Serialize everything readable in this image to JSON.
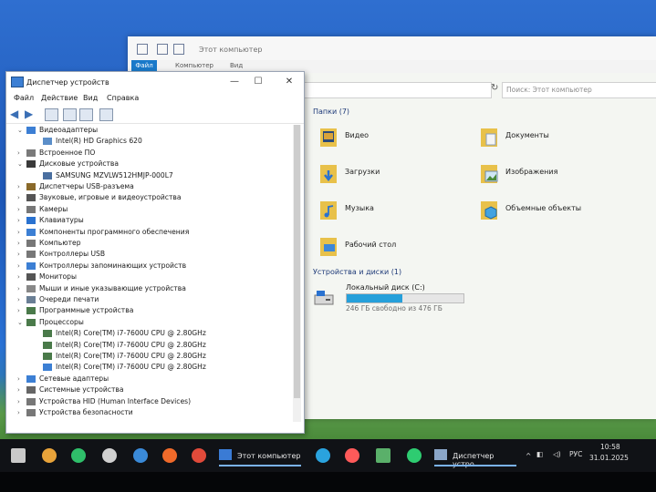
{
  "explorer": {
    "title": "Этот компьютер",
    "ribbon_tabs": [
      "Файл",
      "Компьютер",
      "Вид"
    ],
    "search_placeholder": "Поиск: Этот компьютер",
    "folders_header": "Папки (7)",
    "folders": [
      {
        "label": "Видео",
        "icon": "video-folder-icon"
      },
      {
        "label": "Документы",
        "icon": "documents-folder-icon"
      },
      {
        "label": "Загрузки",
        "icon": "downloads-folder-icon"
      },
      {
        "label": "Изображения",
        "icon": "pictures-folder-icon"
      },
      {
        "label": "Музыка",
        "icon": "music-folder-icon"
      },
      {
        "label": "Объемные объекты",
        "icon": "3d-objects-folder-icon"
      },
      {
        "label": "Рабочий стол",
        "icon": "desktop-folder-icon"
      }
    ],
    "drives_header": "Устройства и диски (1)",
    "drive": {
      "label": "Локальный диск (C:)",
      "free_text": "246 ГБ свободно из 476 ГБ",
      "used_fraction": 0.48
    }
  },
  "devmgr": {
    "title": "Диспетчер устройств",
    "menu": [
      "Файл",
      "Действие",
      "Вид",
      "Справка"
    ],
    "tree": [
      {
        "label": "Видеоадаптеры",
        "level": 0,
        "expanded": true
      },
      {
        "label": "Intel(R) HD Graphics 620",
        "level": 1
      },
      {
        "label": "Встроенное ПО",
        "level": 0
      },
      {
        "label": "Дисковые устройства",
        "level": 0,
        "expanded": true
      },
      {
        "label": "SAMSUNG MZVLW512HMJP-000L7",
        "level": 1
      },
      {
        "label": "Диспетчеры USB-разъема",
        "level": 0
      },
      {
        "label": "Звуковые, игровые и видеоустройства",
        "level": 0
      },
      {
        "label": "Камеры",
        "level": 0
      },
      {
        "label": "Клавиатуры",
        "level": 0
      },
      {
        "label": "Компоненты программного обеспечения",
        "level": 0
      },
      {
        "label": "Компьютер",
        "level": 0
      },
      {
        "label": "Контроллеры USB",
        "level": 0
      },
      {
        "label": "Контроллеры запоминающих устройств",
        "level": 0
      },
      {
        "label": "Мониторы",
        "level": 0
      },
      {
        "label": "Мыши и иные указывающие устройства",
        "level": 0
      },
      {
        "label": "Очереди печати",
        "level": 0
      },
      {
        "label": "Программные устройства",
        "level": 0
      },
      {
        "label": "Процессоры",
        "level": 0,
        "expanded": true
      },
      {
        "label": "Intel(R) Core(TM) i7-7600U CPU @ 2.80GHz",
        "level": 1
      },
      {
        "label": "Intel(R) Core(TM) i7-7600U CPU @ 2.80GHz",
        "level": 1
      },
      {
        "label": "Intel(R) Core(TM) i7-7600U CPU @ 2.80GHz",
        "level": 1
      },
      {
        "label": "Intel(R) Core(TM) i7-7600U CPU @ 2.80GHz",
        "level": 1
      },
      {
        "label": "Сетевые адаптеры",
        "level": 0
      },
      {
        "label": "Системные устройства",
        "level": 0
      },
      {
        "label": "Устройства HID (Human Interface Devices)",
        "level": 0
      },
      {
        "label": "Устройства безопасности",
        "level": 0
      }
    ]
  },
  "taskbar": {
    "explorer_task": "Этот компьютер",
    "devmgr_task": "Диспетчер устро...",
    "lang": "РУС",
    "time": "10:58",
    "date": "31.01.2025"
  }
}
